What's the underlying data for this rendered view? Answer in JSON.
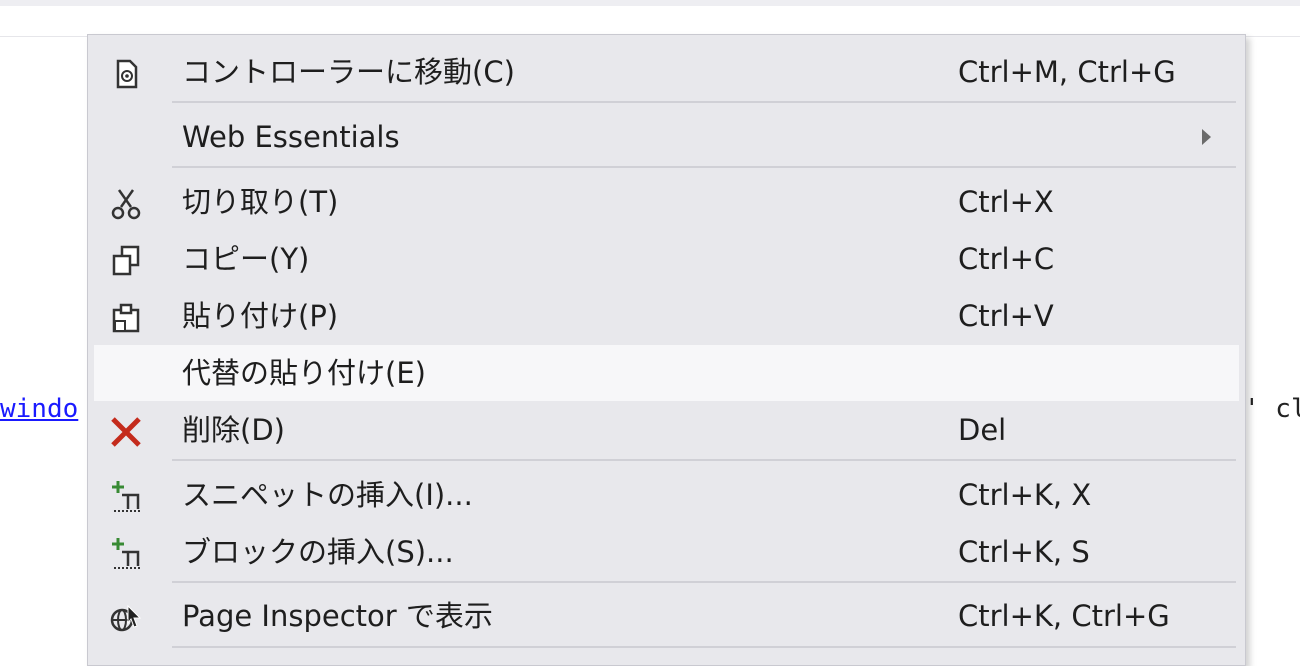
{
  "editor": {
    "code_left": "windo",
    "code_right": "' cl"
  },
  "menu": {
    "items": [
      {
        "label": "コントローラーに移動(C)",
        "shortcut": "Ctrl+M, Ctrl+G",
        "icon": "controller-goto-icon"
      },
      {
        "label": "Web Essentials",
        "shortcut": "",
        "icon": "",
        "submenu": true
      },
      {
        "label": "切り取り(T)",
        "shortcut": "Ctrl+X",
        "icon": "cut-icon"
      },
      {
        "label": "コピー(Y)",
        "shortcut": "Ctrl+C",
        "icon": "copy-icon"
      },
      {
        "label": "貼り付け(P)",
        "shortcut": "Ctrl+V",
        "icon": "paste-icon"
      },
      {
        "label": "代替の貼り付け(E)",
        "shortcut": "",
        "icon": "",
        "highlighted": true
      },
      {
        "label": "削除(D)",
        "shortcut": "Del",
        "icon": "delete-icon"
      },
      {
        "label": "スニペットの挿入(I)...",
        "shortcut": "Ctrl+K, X",
        "icon": "insert-snippet-icon"
      },
      {
        "label": "ブロックの挿入(S)...",
        "shortcut": "Ctrl+K, S",
        "icon": "surround-with-icon"
      },
      {
        "label": "Page Inspector で表示",
        "shortcut": "Ctrl+K, Ctrl+G",
        "icon": "page-inspector-icon"
      }
    ]
  },
  "colors": {
    "menu_bg": "#e8e8ec",
    "highlight_bg": "#f7f7f9",
    "delete_red": "#c42b1c",
    "insert_green": "#388a34"
  }
}
